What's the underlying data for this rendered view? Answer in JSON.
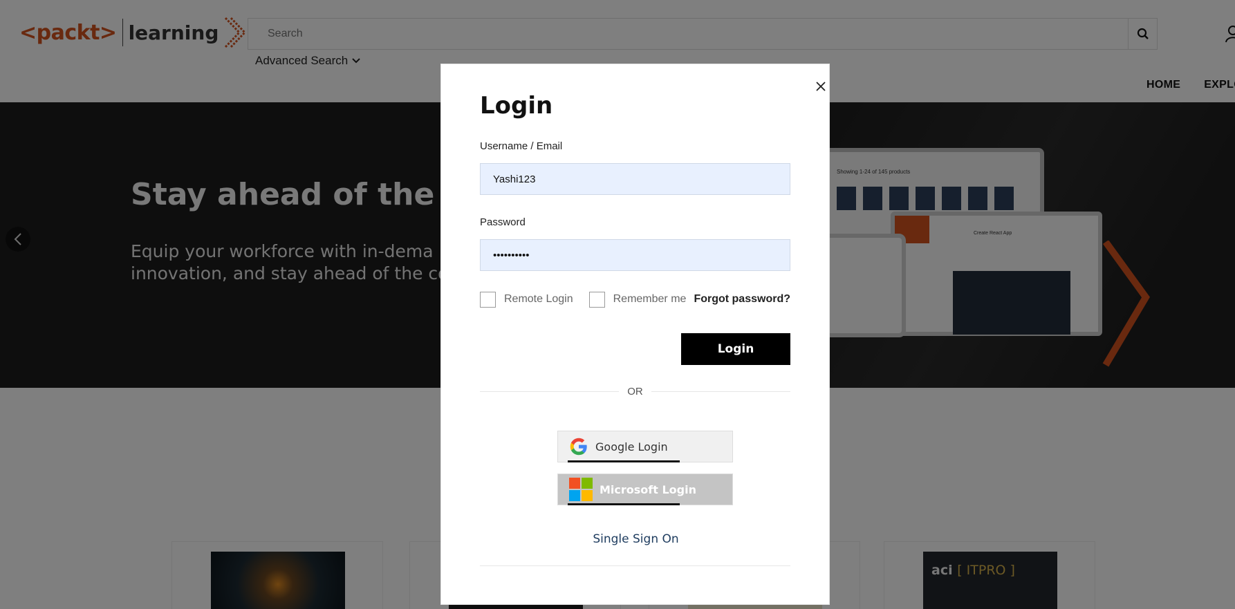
{
  "header": {
    "logo_brand": "<packt>",
    "logo_product": "learning",
    "search_placeholder": "Search",
    "advanced_search": "Advanced Search",
    "nav": [
      "HOME",
      "EXPLO"
    ]
  },
  "hero": {
    "title": "Stay ahead of the curv",
    "subtitle_line1": "Equip your workforce with in-dema",
    "subtitle_line2": "innovation, and stay ahead of the com",
    "laptop_heading": "Showing 1-24 of 145 products",
    "monitor_title": "Create React App"
  },
  "cards": {
    "card4_logo": "aci",
    "card4_tag": "[ ITPRO ]"
  },
  "modal": {
    "title": "Login",
    "username_label": "Username / Email",
    "username_value": "Yashi123",
    "password_label": "Password",
    "password_value": "••••••••••",
    "remote_login": "Remote Login",
    "remember_me": "Remember me",
    "forgot_password": "Forgot password?",
    "login_button": "Login",
    "or_text": "OR",
    "google_login": "Google Login",
    "microsoft_login": "Microsoft Login",
    "single_sign_on": "Single Sign On"
  },
  "colors": {
    "brand_orange": "#d2521f",
    "field_bg": "#e8f0fe",
    "sso_link": "#1d3b5e"
  }
}
